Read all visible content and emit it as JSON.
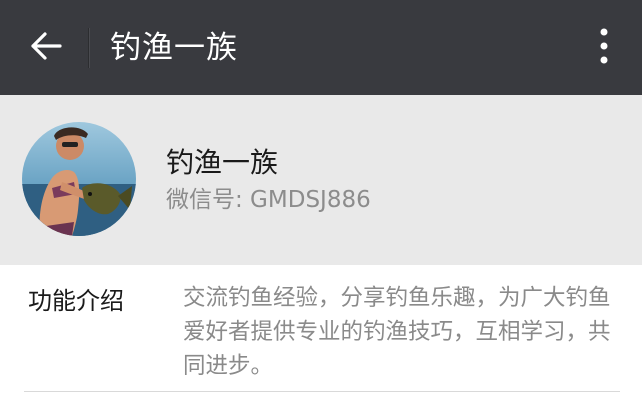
{
  "header": {
    "title": "钓渔一族",
    "back_icon": "arrow-left-icon",
    "more_icon": "more-vertical-icon",
    "background": "#393a3f"
  },
  "profile": {
    "name": "钓渔一族",
    "wechat_id": "微信号: GMDSJ886",
    "avatar": "avatar-photo",
    "background": "#e9e9e9"
  },
  "info": {
    "label": "功能介绍",
    "description": "交流钓鱼经验，分享钓鱼乐趣，为广大钓鱼爱好者提供专业的钓渔技巧，互相学习，共同进步。"
  }
}
